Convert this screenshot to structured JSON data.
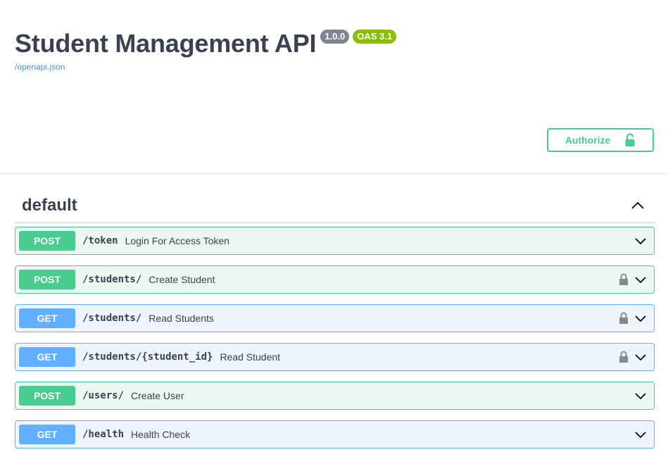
{
  "info": {
    "title": "Student Management API",
    "version": "1.0.0",
    "oas": "OAS 3.1",
    "spec_link": "/openapi.json"
  },
  "authorize": {
    "label": "Authorize"
  },
  "tag": {
    "name": "default"
  },
  "colors": {
    "post": "#49cc90",
    "get": "#61affe",
    "text": "#3b4151",
    "link": "#4990e2"
  },
  "operations": [
    {
      "method": "POST",
      "path": "/token",
      "summary": "Login For Access Token",
      "locked": false
    },
    {
      "method": "POST",
      "path": "/students/",
      "summary": "Create Student",
      "locked": true
    },
    {
      "method": "GET",
      "path": "/students/",
      "summary": "Read Students",
      "locked": true
    },
    {
      "method": "GET",
      "path": "/students/{student_id}",
      "summary": "Read Student",
      "locked": true
    },
    {
      "method": "POST",
      "path": "/users/",
      "summary": "Create User",
      "locked": false
    },
    {
      "method": "GET",
      "path": "/health",
      "summary": "Health Check",
      "locked": false
    }
  ]
}
